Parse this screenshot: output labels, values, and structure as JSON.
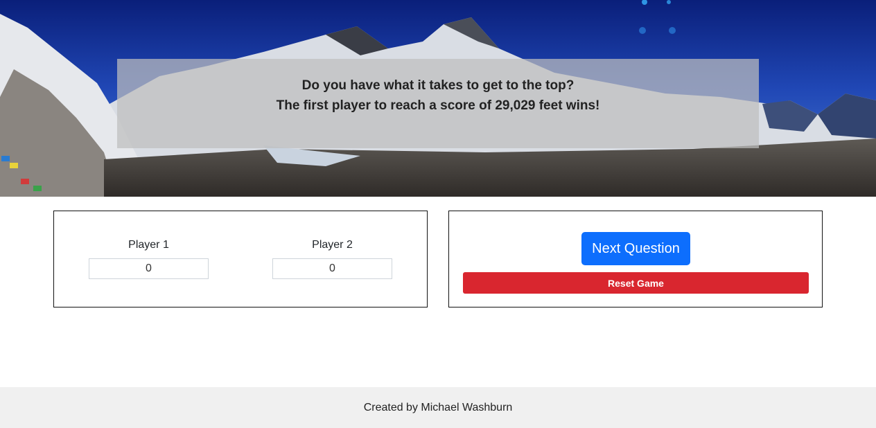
{
  "hero": {
    "line1": "Do you have what it takes to get to the top?",
    "line2": "The first player to reach a score of 29,029 feet wins!"
  },
  "scoreboard": {
    "players": [
      {
        "label": "Player 1",
        "score": "0"
      },
      {
        "label": "Player 2",
        "score": "0"
      }
    ]
  },
  "controls": {
    "next_label": "Next Question",
    "reset_label": "Reset Game"
  },
  "footer": {
    "text": "Created by Michael Washburn"
  },
  "colors": {
    "primary": "#0d6efd",
    "danger": "#d9262f",
    "footer_bg": "#f0f0f0"
  }
}
